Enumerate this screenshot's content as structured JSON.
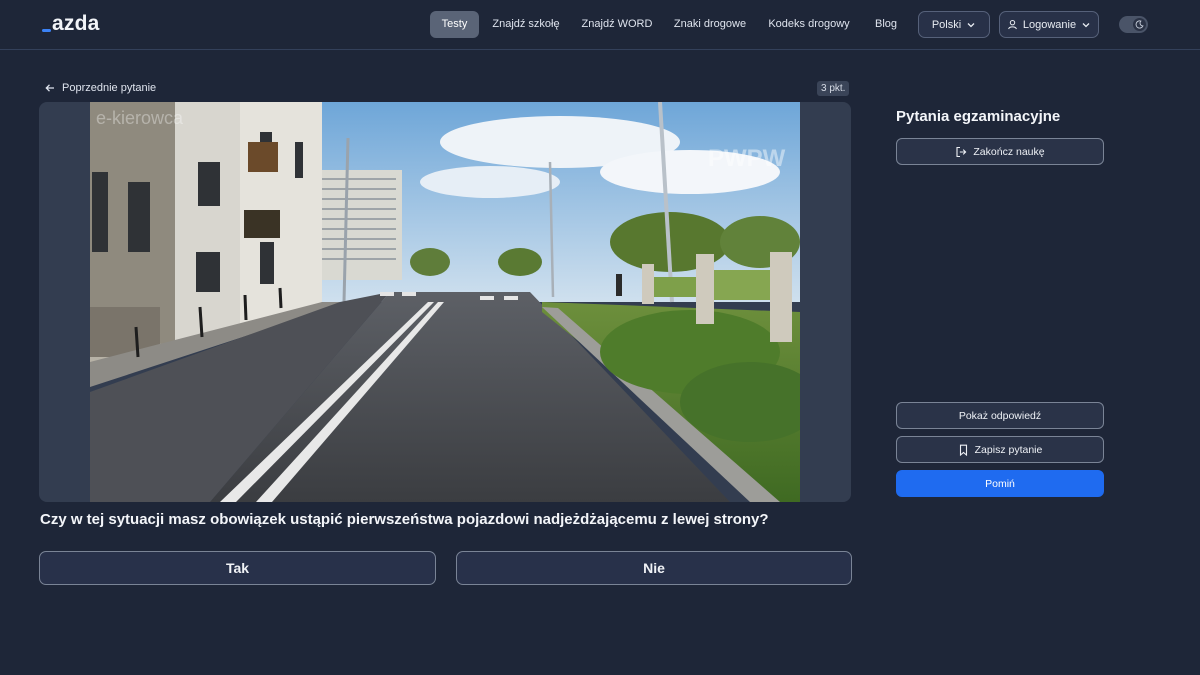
{
  "header": {
    "logo_text": "azda",
    "nav": [
      "Testy",
      "Znajdź szkołę",
      "Znajdź WORD",
      "Znaki drogowe",
      "Kodeks drogowy",
      "Blog"
    ],
    "active_nav": "Testy",
    "language_label": "Polski",
    "login_label": "Logowanie",
    "theme_toggle_icon": "moon-icon"
  },
  "question": {
    "back_label": "Poprzednie pytanie",
    "points_label": "3 pkt.",
    "image_watermarks": [
      "e-kierowca",
      "PWPW"
    ],
    "text": "Czy w tej sytuacji masz obowiązek ustąpić pierwszeństwa pojazdowi nadjeżdżającemu z lewej strony?",
    "answers": [
      "Tak",
      "Nie"
    ]
  },
  "sidebar": {
    "title": "Pytania egzaminacyjne",
    "end_label": "Zakończ naukę",
    "show_answer_label": "Pokaż odpowiedź",
    "save_label": "Zapisz pytanie",
    "skip_label": "Pomiń"
  },
  "colors": {
    "background": "#1e2638",
    "primary": "#1f6bf0",
    "accent_logo": "#3b82f6"
  }
}
